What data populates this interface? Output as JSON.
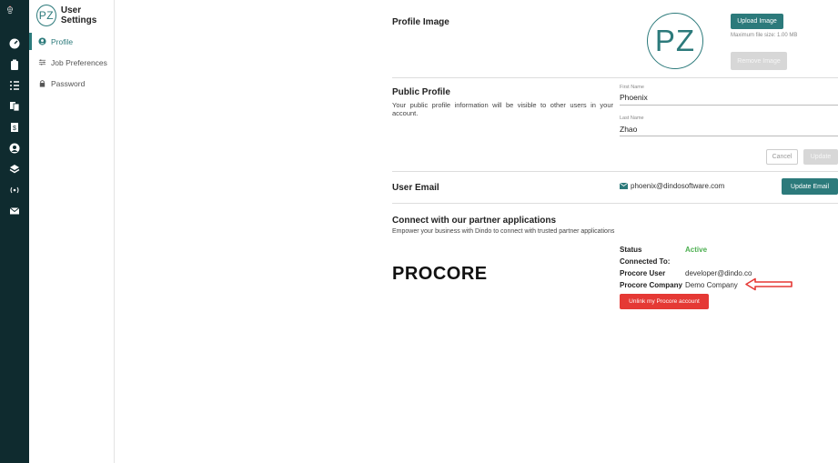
{
  "sidebar": {
    "title": "User Settings",
    "avatar_initials": "PZ",
    "items": [
      {
        "label": "Profile",
        "icon": "user-circle-icon",
        "active": true
      },
      {
        "label": "Job Preferences",
        "icon": "sliders-icon",
        "active": false
      },
      {
        "label": "Password",
        "icon": "lock-icon",
        "active": false
      }
    ]
  },
  "rail": {
    "icons": [
      "dashboard-icon",
      "clipboard-icon",
      "list-icon",
      "copy-icon",
      "invoice-icon",
      "user-icon",
      "layers-icon",
      "signal-icon",
      "mail-icon"
    ]
  },
  "profile_image": {
    "title": "Profile Image",
    "initials": "PZ",
    "upload_label": "Upload Image",
    "max_size": "Maximum file size: 1.00 MB",
    "remove_label": "Remove Image"
  },
  "public_profile": {
    "title": "Public Profile",
    "description": "Your public profile information will be visible to other users in your account.",
    "first_name_label": "First Name",
    "first_name": "Phoenix",
    "last_name_label": "Last Name",
    "last_name": "Zhao",
    "cancel_label": "Cancel",
    "update_label": "Update"
  },
  "user_email": {
    "title": "User Email",
    "email": "phoenix@dindosoftware.com",
    "update_label": "Update Email"
  },
  "partners": {
    "title": "Connect with our partner applications",
    "subtitle": "Empower your business with Dindo to connect with trusted partner applications",
    "logo_text": "PROCORE",
    "status_key": "Status",
    "status_value": "Active",
    "connected_to_key": "Connected To:",
    "procore_user_key": "Procore User",
    "procore_user_value": "developer@dindo.co",
    "procore_company_key": "Procore Company",
    "procore_company_value": "Demo Company",
    "unlink_label": "Unlink my Procore account"
  },
  "colors": {
    "teal": "#2c7a7b",
    "rail": "#0f2b2f",
    "red": "#e53935",
    "active_green": "#4caf50"
  }
}
